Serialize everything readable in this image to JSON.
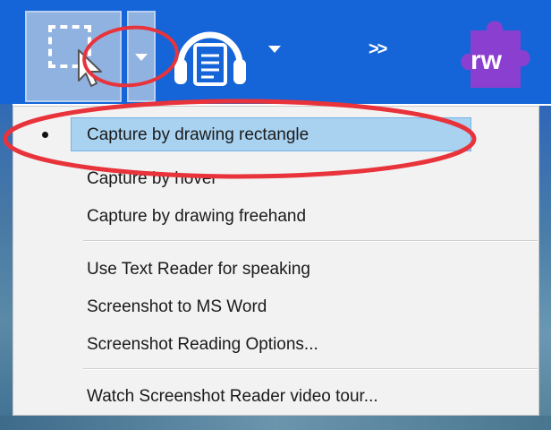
{
  "toolbar": {
    "more_label": ">>",
    "logo_text": "rw",
    "buttons": [
      {
        "name": "capture-mode",
        "icon": "selection-rectangle-cursor-icon"
      },
      {
        "name": "capture-dropdown",
        "icon": "chevron-down-icon"
      },
      {
        "name": "screenshot-reader",
        "icon": "headphones-document-icon"
      },
      {
        "name": "reader-dropdown",
        "icon": "chevron-down-icon"
      },
      {
        "name": "more-tools",
        "icon": "double-chevron-right-icon"
      },
      {
        "name": "readwrite-logo",
        "icon": "puzzle-piece-icon"
      }
    ]
  },
  "menu": {
    "items": [
      {
        "label": "Capture by drawing rectangle",
        "selected": true
      },
      {
        "label": "Capture by hover",
        "selected": false
      },
      {
        "label": "Capture by drawing freehand",
        "selected": false
      },
      {
        "label": "Use Text Reader for speaking",
        "selected": false
      },
      {
        "label": "Screenshot to MS Word",
        "selected": false
      },
      {
        "label": "Screenshot Reading Options...",
        "selected": false
      },
      {
        "label": "Watch Screenshot Reader video tour...",
        "selected": false
      }
    ]
  },
  "colors": {
    "toolbar_bg": "#1565d8",
    "menu_bg": "#f2f2f2",
    "highlight": "#a9d2f1",
    "annotation": "#e8333b",
    "logo_purple": "#8b3fd0"
  }
}
